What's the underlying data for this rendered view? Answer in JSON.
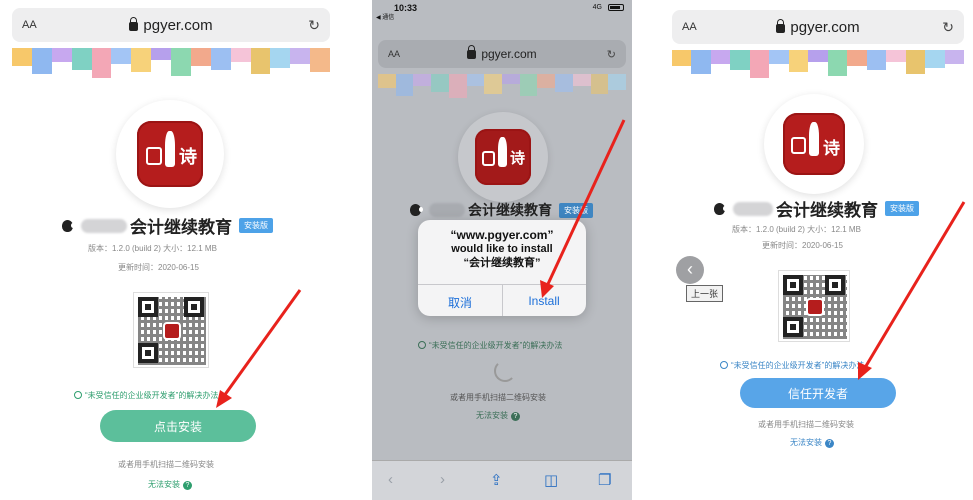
{
  "colors": {
    "app_red": "#b51d1d",
    "install_green": "#5cbf9b",
    "trust_blue": "#58a5e8",
    "link_green": "#2e9e6e",
    "link_blue": "#3b86c6",
    "arrow_red": "#e8221c"
  },
  "browser": {
    "text_size": "AA",
    "domain": "pgyer.com",
    "lock_icon": "lock-icon",
    "reload_icon": "reload-icon"
  },
  "app": {
    "name": "会计继续教育",
    "badge": "安装版",
    "icon_glyph": "诗",
    "version_text": "版本：1.2.0 (build 2)   大小：12.1 MB",
    "update_text": "更新时间：2020-06-15"
  },
  "screen1": {
    "trust_link": "“未受信任的企业级开发者”的解决办法",
    "install_button": "点击安装",
    "scan_text": "或者用手机扫描二维码安装",
    "cant_install": "无法安装"
  },
  "screen2": {
    "status_time": "10:33",
    "status_back": "◀ 通信",
    "status_network": "4G",
    "dialog_line1": "“www.pgyer.com”",
    "dialog_line2": "would like to install",
    "dialog_line3": "“会计继续教育”",
    "dialog_cancel": "取消",
    "dialog_install": "Install",
    "trust_link": "“未受信任的企业级开发者”的解决办法",
    "scan_text": "或者用手机扫描二维码安装",
    "cant_install": "无法安装"
  },
  "screen3": {
    "prev_label": "上一张",
    "trust_link": "“未受信任的企业级开发者”的解决办法",
    "trust_button": "信任开发者",
    "scan_text": "或者用手机扫描二维码安装",
    "cant_install": "无法安装"
  }
}
